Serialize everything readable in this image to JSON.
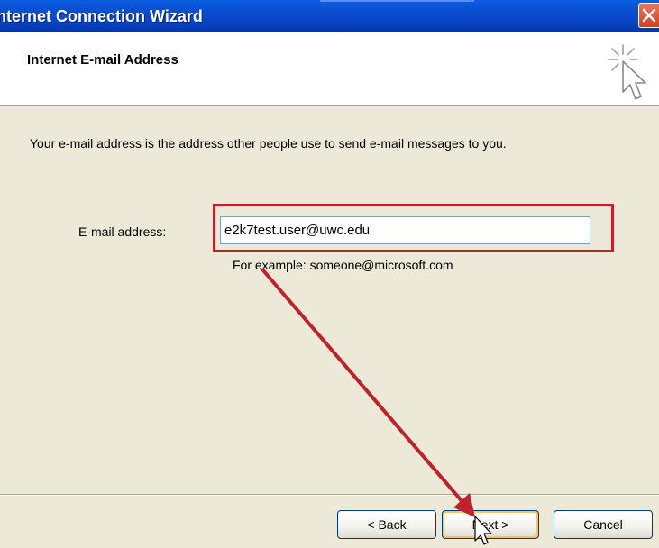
{
  "window": {
    "title": "Internet Connection Wizard",
    "title_visible": "nternet Connection Wizard"
  },
  "header": {
    "title": "Internet E-mail Address",
    "icon": "wizard-cursor-icon"
  },
  "body": {
    "intro": "Your e-mail address is the address other people use to send e-mail messages to you.",
    "email_label": "E-mail address:",
    "email_value": "e2k7test.user@uwc.edu",
    "example": "For example: someone@microsoft.com"
  },
  "footer": {
    "back_label": "< Back",
    "next_label": "Next >",
    "cancel_label": "Cancel"
  },
  "annotation": {
    "highlight_color": "#c0212a",
    "arrow_color": "#c0212a"
  },
  "colors": {
    "titlebar": "#0b4fd3",
    "dialog_bg": "#ece9d8",
    "header_bg": "#ffffff"
  }
}
